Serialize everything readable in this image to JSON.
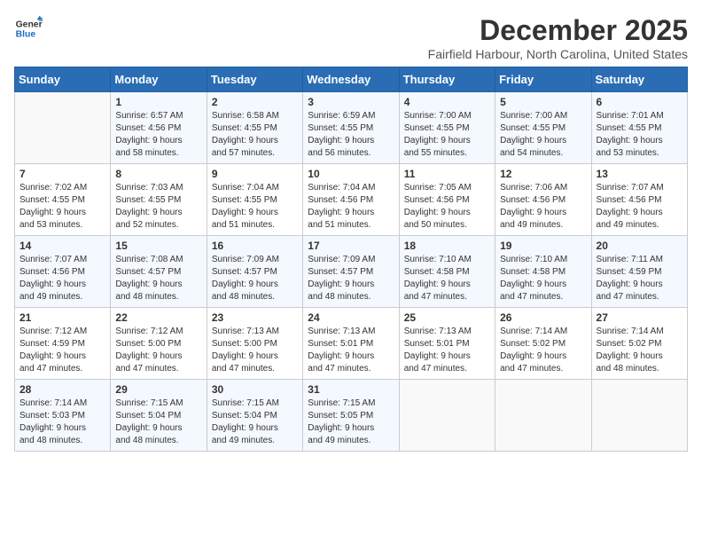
{
  "logo": {
    "line1": "General",
    "line2": "Blue"
  },
  "title": "December 2025",
  "location": "Fairfield Harbour, North Carolina, United States",
  "days_of_week": [
    "Sunday",
    "Monday",
    "Tuesday",
    "Wednesday",
    "Thursday",
    "Friday",
    "Saturday"
  ],
  "weeks": [
    [
      {
        "day": "",
        "content": ""
      },
      {
        "day": "1",
        "content": "Sunrise: 6:57 AM\nSunset: 4:56 PM\nDaylight: 9 hours\nand 58 minutes."
      },
      {
        "day": "2",
        "content": "Sunrise: 6:58 AM\nSunset: 4:55 PM\nDaylight: 9 hours\nand 57 minutes."
      },
      {
        "day": "3",
        "content": "Sunrise: 6:59 AM\nSunset: 4:55 PM\nDaylight: 9 hours\nand 56 minutes."
      },
      {
        "day": "4",
        "content": "Sunrise: 7:00 AM\nSunset: 4:55 PM\nDaylight: 9 hours\nand 55 minutes."
      },
      {
        "day": "5",
        "content": "Sunrise: 7:00 AM\nSunset: 4:55 PM\nDaylight: 9 hours\nand 54 minutes."
      },
      {
        "day": "6",
        "content": "Sunrise: 7:01 AM\nSunset: 4:55 PM\nDaylight: 9 hours\nand 53 minutes."
      }
    ],
    [
      {
        "day": "7",
        "content": "Sunrise: 7:02 AM\nSunset: 4:55 PM\nDaylight: 9 hours\nand 53 minutes."
      },
      {
        "day": "8",
        "content": "Sunrise: 7:03 AM\nSunset: 4:55 PM\nDaylight: 9 hours\nand 52 minutes."
      },
      {
        "day": "9",
        "content": "Sunrise: 7:04 AM\nSunset: 4:55 PM\nDaylight: 9 hours\nand 51 minutes."
      },
      {
        "day": "10",
        "content": "Sunrise: 7:04 AM\nSunset: 4:56 PM\nDaylight: 9 hours\nand 51 minutes."
      },
      {
        "day": "11",
        "content": "Sunrise: 7:05 AM\nSunset: 4:56 PM\nDaylight: 9 hours\nand 50 minutes."
      },
      {
        "day": "12",
        "content": "Sunrise: 7:06 AM\nSunset: 4:56 PM\nDaylight: 9 hours\nand 49 minutes."
      },
      {
        "day": "13",
        "content": "Sunrise: 7:07 AM\nSunset: 4:56 PM\nDaylight: 9 hours\nand 49 minutes."
      }
    ],
    [
      {
        "day": "14",
        "content": "Sunrise: 7:07 AM\nSunset: 4:56 PM\nDaylight: 9 hours\nand 49 minutes."
      },
      {
        "day": "15",
        "content": "Sunrise: 7:08 AM\nSunset: 4:57 PM\nDaylight: 9 hours\nand 48 minutes."
      },
      {
        "day": "16",
        "content": "Sunrise: 7:09 AM\nSunset: 4:57 PM\nDaylight: 9 hours\nand 48 minutes."
      },
      {
        "day": "17",
        "content": "Sunrise: 7:09 AM\nSunset: 4:57 PM\nDaylight: 9 hours\nand 48 minutes."
      },
      {
        "day": "18",
        "content": "Sunrise: 7:10 AM\nSunset: 4:58 PM\nDaylight: 9 hours\nand 47 minutes."
      },
      {
        "day": "19",
        "content": "Sunrise: 7:10 AM\nSunset: 4:58 PM\nDaylight: 9 hours\nand 47 minutes."
      },
      {
        "day": "20",
        "content": "Sunrise: 7:11 AM\nSunset: 4:59 PM\nDaylight: 9 hours\nand 47 minutes."
      }
    ],
    [
      {
        "day": "21",
        "content": "Sunrise: 7:12 AM\nSunset: 4:59 PM\nDaylight: 9 hours\nand 47 minutes."
      },
      {
        "day": "22",
        "content": "Sunrise: 7:12 AM\nSunset: 5:00 PM\nDaylight: 9 hours\nand 47 minutes."
      },
      {
        "day": "23",
        "content": "Sunrise: 7:13 AM\nSunset: 5:00 PM\nDaylight: 9 hours\nand 47 minutes."
      },
      {
        "day": "24",
        "content": "Sunrise: 7:13 AM\nSunset: 5:01 PM\nDaylight: 9 hours\nand 47 minutes."
      },
      {
        "day": "25",
        "content": "Sunrise: 7:13 AM\nSunset: 5:01 PM\nDaylight: 9 hours\nand 47 minutes."
      },
      {
        "day": "26",
        "content": "Sunrise: 7:14 AM\nSunset: 5:02 PM\nDaylight: 9 hours\nand 47 minutes."
      },
      {
        "day": "27",
        "content": "Sunrise: 7:14 AM\nSunset: 5:02 PM\nDaylight: 9 hours\nand 48 minutes."
      }
    ],
    [
      {
        "day": "28",
        "content": "Sunrise: 7:14 AM\nSunset: 5:03 PM\nDaylight: 9 hours\nand 48 minutes."
      },
      {
        "day": "29",
        "content": "Sunrise: 7:15 AM\nSunset: 5:04 PM\nDaylight: 9 hours\nand 48 minutes."
      },
      {
        "day": "30",
        "content": "Sunrise: 7:15 AM\nSunset: 5:04 PM\nDaylight: 9 hours\nand 49 minutes."
      },
      {
        "day": "31",
        "content": "Sunrise: 7:15 AM\nSunset: 5:05 PM\nDaylight: 9 hours\nand 49 minutes."
      },
      {
        "day": "",
        "content": ""
      },
      {
        "day": "",
        "content": ""
      },
      {
        "day": "",
        "content": ""
      }
    ]
  ]
}
